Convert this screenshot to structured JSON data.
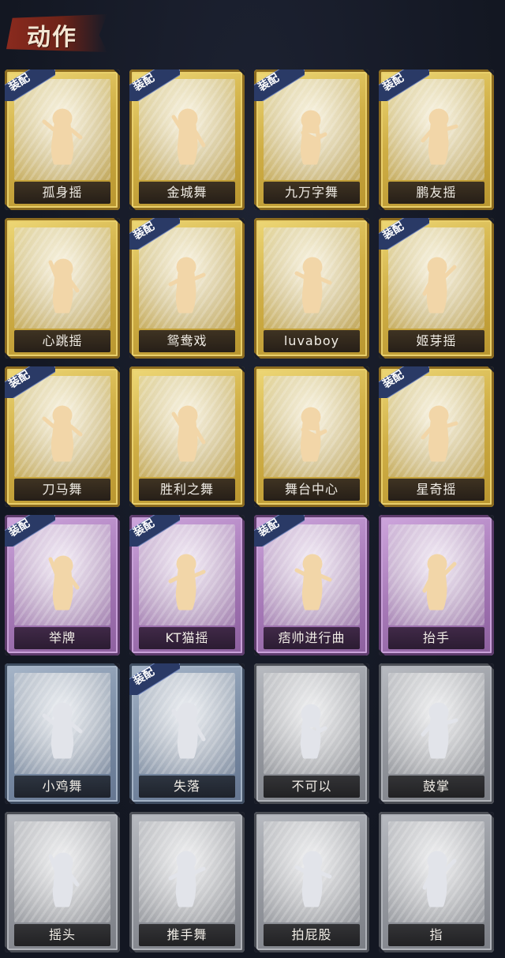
{
  "header": {
    "title": "动作"
  },
  "equip_label": "装配",
  "cards": [
    {
      "name": "孤身摇",
      "tier": "gold",
      "equipped": true,
      "pose": "a"
    },
    {
      "name": "金城舞",
      "tier": "gold",
      "equipped": true,
      "pose": "b"
    },
    {
      "name": "九万字舞",
      "tier": "gold",
      "equipped": true,
      "pose": "c"
    },
    {
      "name": "鹏友摇",
      "tier": "gold",
      "equipped": true,
      "pose": "d"
    },
    {
      "name": "心跳摇",
      "tier": "gold",
      "equipped": false,
      "pose": "e"
    },
    {
      "name": "鸳鸯戏",
      "tier": "gold",
      "equipped": true,
      "pose": "f"
    },
    {
      "name": "luvaboy",
      "tier": "gold",
      "equipped": false,
      "pose": "g"
    },
    {
      "name": "姬芽摇",
      "tier": "gold",
      "equipped": true,
      "pose": "h"
    },
    {
      "name": "刀马舞",
      "tier": "gold",
      "equipped": true,
      "pose": "a"
    },
    {
      "name": "胜利之舞",
      "tier": "gold",
      "equipped": false,
      "pose": "b"
    },
    {
      "name": "舞台中心",
      "tier": "gold",
      "equipped": false,
      "pose": "c"
    },
    {
      "name": "星奇摇",
      "tier": "gold",
      "equipped": true,
      "pose": "d"
    },
    {
      "name": "举牌",
      "tier": "purple",
      "equipped": true,
      "pose": "e"
    },
    {
      "name": "KT猫摇",
      "tier": "purple",
      "equipped": true,
      "pose": "f"
    },
    {
      "name": "痞帅进行曲",
      "tier": "purple",
      "equipped": true,
      "pose": "g"
    },
    {
      "name": "抬手",
      "tier": "purple",
      "equipped": false,
      "pose": "h"
    },
    {
      "name": "小鸡舞",
      "tier": "blue",
      "equipped": false,
      "pose": "a"
    },
    {
      "name": "失落",
      "tier": "blue",
      "equipped": true,
      "pose": "b"
    },
    {
      "name": "不可以",
      "tier": "gray",
      "equipped": false,
      "pose": "c"
    },
    {
      "name": "鼓掌",
      "tier": "gray",
      "equipped": false,
      "pose": "d"
    },
    {
      "name": "摇头",
      "tier": "gray",
      "equipped": false,
      "pose": "e"
    },
    {
      "name": "推手舞",
      "tier": "gray",
      "equipped": false,
      "pose": "f"
    },
    {
      "name": "拍屁股",
      "tier": "gray",
      "equipped": false,
      "pose": "g"
    },
    {
      "name": "指",
      "tier": "gray",
      "equipped": false,
      "pose": "h"
    }
  ],
  "colors": {
    "gold": "#cfae45",
    "purple": "#a77ab8",
    "blue": "#7c8ea6",
    "gray": "#92959c",
    "badge": "#2a3a66",
    "figure_gold": "#f2d6a8",
    "figure_gray": "#e2e4ea"
  }
}
